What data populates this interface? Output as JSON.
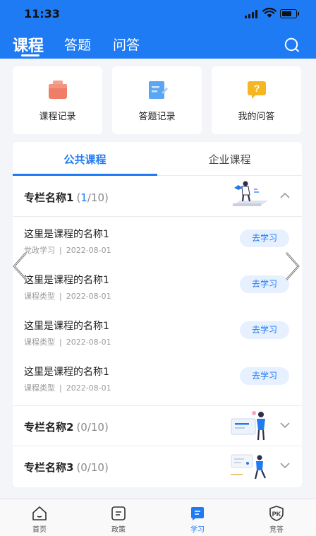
{
  "status_bar": {
    "time": "11:33"
  },
  "header": {
    "tabs": [
      {
        "label": "课程",
        "active": true
      },
      {
        "label": "答题",
        "active": false
      },
      {
        "label": "问答",
        "active": false
      }
    ],
    "search_icon": "search-icon",
    "color": "#1f7bf3"
  },
  "quick_links": [
    {
      "label": "课程记录",
      "icon": "course-record-icon",
      "color": "#f0806a"
    },
    {
      "label": "答题记录",
      "icon": "answer-record-icon",
      "color": "#5aa6f2"
    },
    {
      "label": "我的问答",
      "icon": "my-qa-icon",
      "color": "#f5b622"
    }
  ],
  "content_tabs": [
    {
      "label": "公共课程",
      "active": true
    },
    {
      "label": "企业课程",
      "active": false
    }
  ],
  "sections": [
    {
      "title": "专栏名称1",
      "count_current": "1",
      "count_total": "/10",
      "expanded": true,
      "courses": [
        {
          "name": "这里是课程的名称1",
          "category": "党政学习",
          "date": "2022-08-01",
          "action": "去学习"
        },
        {
          "name": "这里是课程的名称1",
          "category": "课程类型",
          "date": "2022-08-01",
          "action": "去学习"
        },
        {
          "name": "这里是课程的名称1",
          "category": "课程类型",
          "date": "2022-08-01",
          "action": "去学习"
        },
        {
          "name": "这里是课程的名称1",
          "category": "课程类型",
          "date": "2022-08-01",
          "action": "去学习"
        }
      ]
    },
    {
      "title": "专栏名称2",
      "count": "(0/10)",
      "expanded": false
    },
    {
      "title": "专栏名称3",
      "count": "(0/10)",
      "expanded": false
    }
  ],
  "bottom_nav": [
    {
      "label": "首页",
      "icon": "home-icon",
      "active": false
    },
    {
      "label": "政策",
      "icon": "policy-icon",
      "active": false
    },
    {
      "label": "学习",
      "icon": "study-icon",
      "active": true
    },
    {
      "label": "竞答",
      "icon": "quiz-icon",
      "active": false
    }
  ],
  "colors": {
    "accent": "#1f7bf3",
    "accent_light": "#e6f0ff",
    "background": "#f3f5f9"
  }
}
